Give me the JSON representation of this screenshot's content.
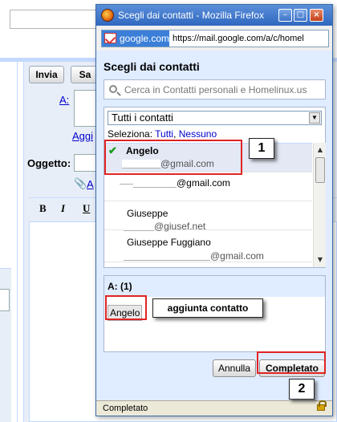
{
  "background": {
    "send_label": "Invia",
    "save_label": "Sa",
    "to_label": "A:",
    "add_link": "Aggi",
    "subject_label": "Oggetto:",
    "attach_link": "A",
    "format_bold": "B",
    "format_italic": "I",
    "format_underline": "U"
  },
  "window": {
    "title": "Scegli dai contatti - Mozilla Firefox",
    "site_label": "google.com",
    "url": "https://mail.google.com/a/c/homel"
  },
  "picker": {
    "heading": "Scegli dai contatti",
    "search_placeholder": "Cerca in Contatti personali e Homelinux.us",
    "group": "Tutti i contatti",
    "select_label": "Seleziona:",
    "select_all": "Tutti",
    "select_none": "Nessuno",
    "contacts": [
      {
        "name": "Angelo",
        "email": "@gmail.com",
        "selected": true
      },
      {
        "name": "",
        "email": "@gmail.com",
        "selected": false
      },
      {
        "name": "Giuseppe",
        "email": "@giusef.net",
        "selected": false
      },
      {
        "name": "Giuseppe Fuggiano",
        "email": "@gmail.com",
        "selected": false
      }
    ],
    "to_header": "A: (1)",
    "chip": "Angelo",
    "cancel": "Annulla",
    "done": "Completato"
  },
  "status": {
    "text": "Completato"
  },
  "annotations": {
    "step1": "1",
    "step2": "2",
    "note": "aggiunta contatto"
  }
}
